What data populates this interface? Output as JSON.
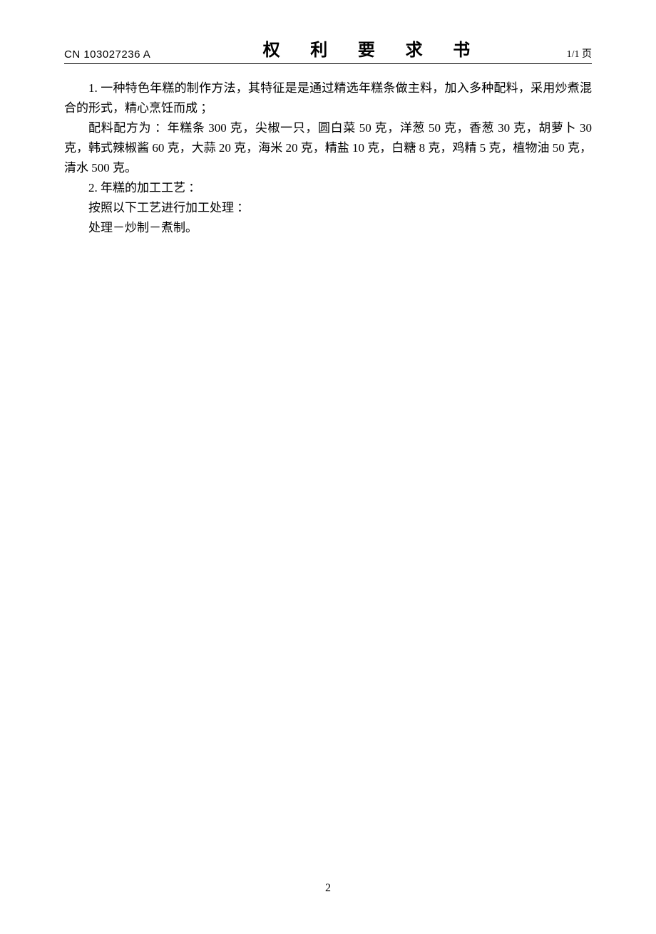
{
  "header": {
    "doc_id": "CN 103027236 A",
    "title": "权 利 要 求 书",
    "page_label": "1/1 页"
  },
  "body": {
    "p1": "1. 一种特色年糕的制作方法，其特征是是通过精选年糕条做主料，加入多种配料，采用炒煮混合的形式，精心烹饪而成 ；",
    "p2": "配料配方为 ：年糕条 300 克，尖椒一只，圆白菜 50 克，洋葱 50 克，香葱 30 克，胡萝卜 30克，韩式辣椒酱 60 克，大蒜 20 克，海米 20 克，精盐 10 克，白糖 8 克，鸡精 5 克，植物油 50 克，清水 500 克。",
    "p3": "2. 年糕的加工工艺 ：",
    "p4": "按照以下工艺进行加工处理 ：",
    "p5": "处理－炒制－煮制。"
  },
  "footer": {
    "page_number": "2"
  }
}
